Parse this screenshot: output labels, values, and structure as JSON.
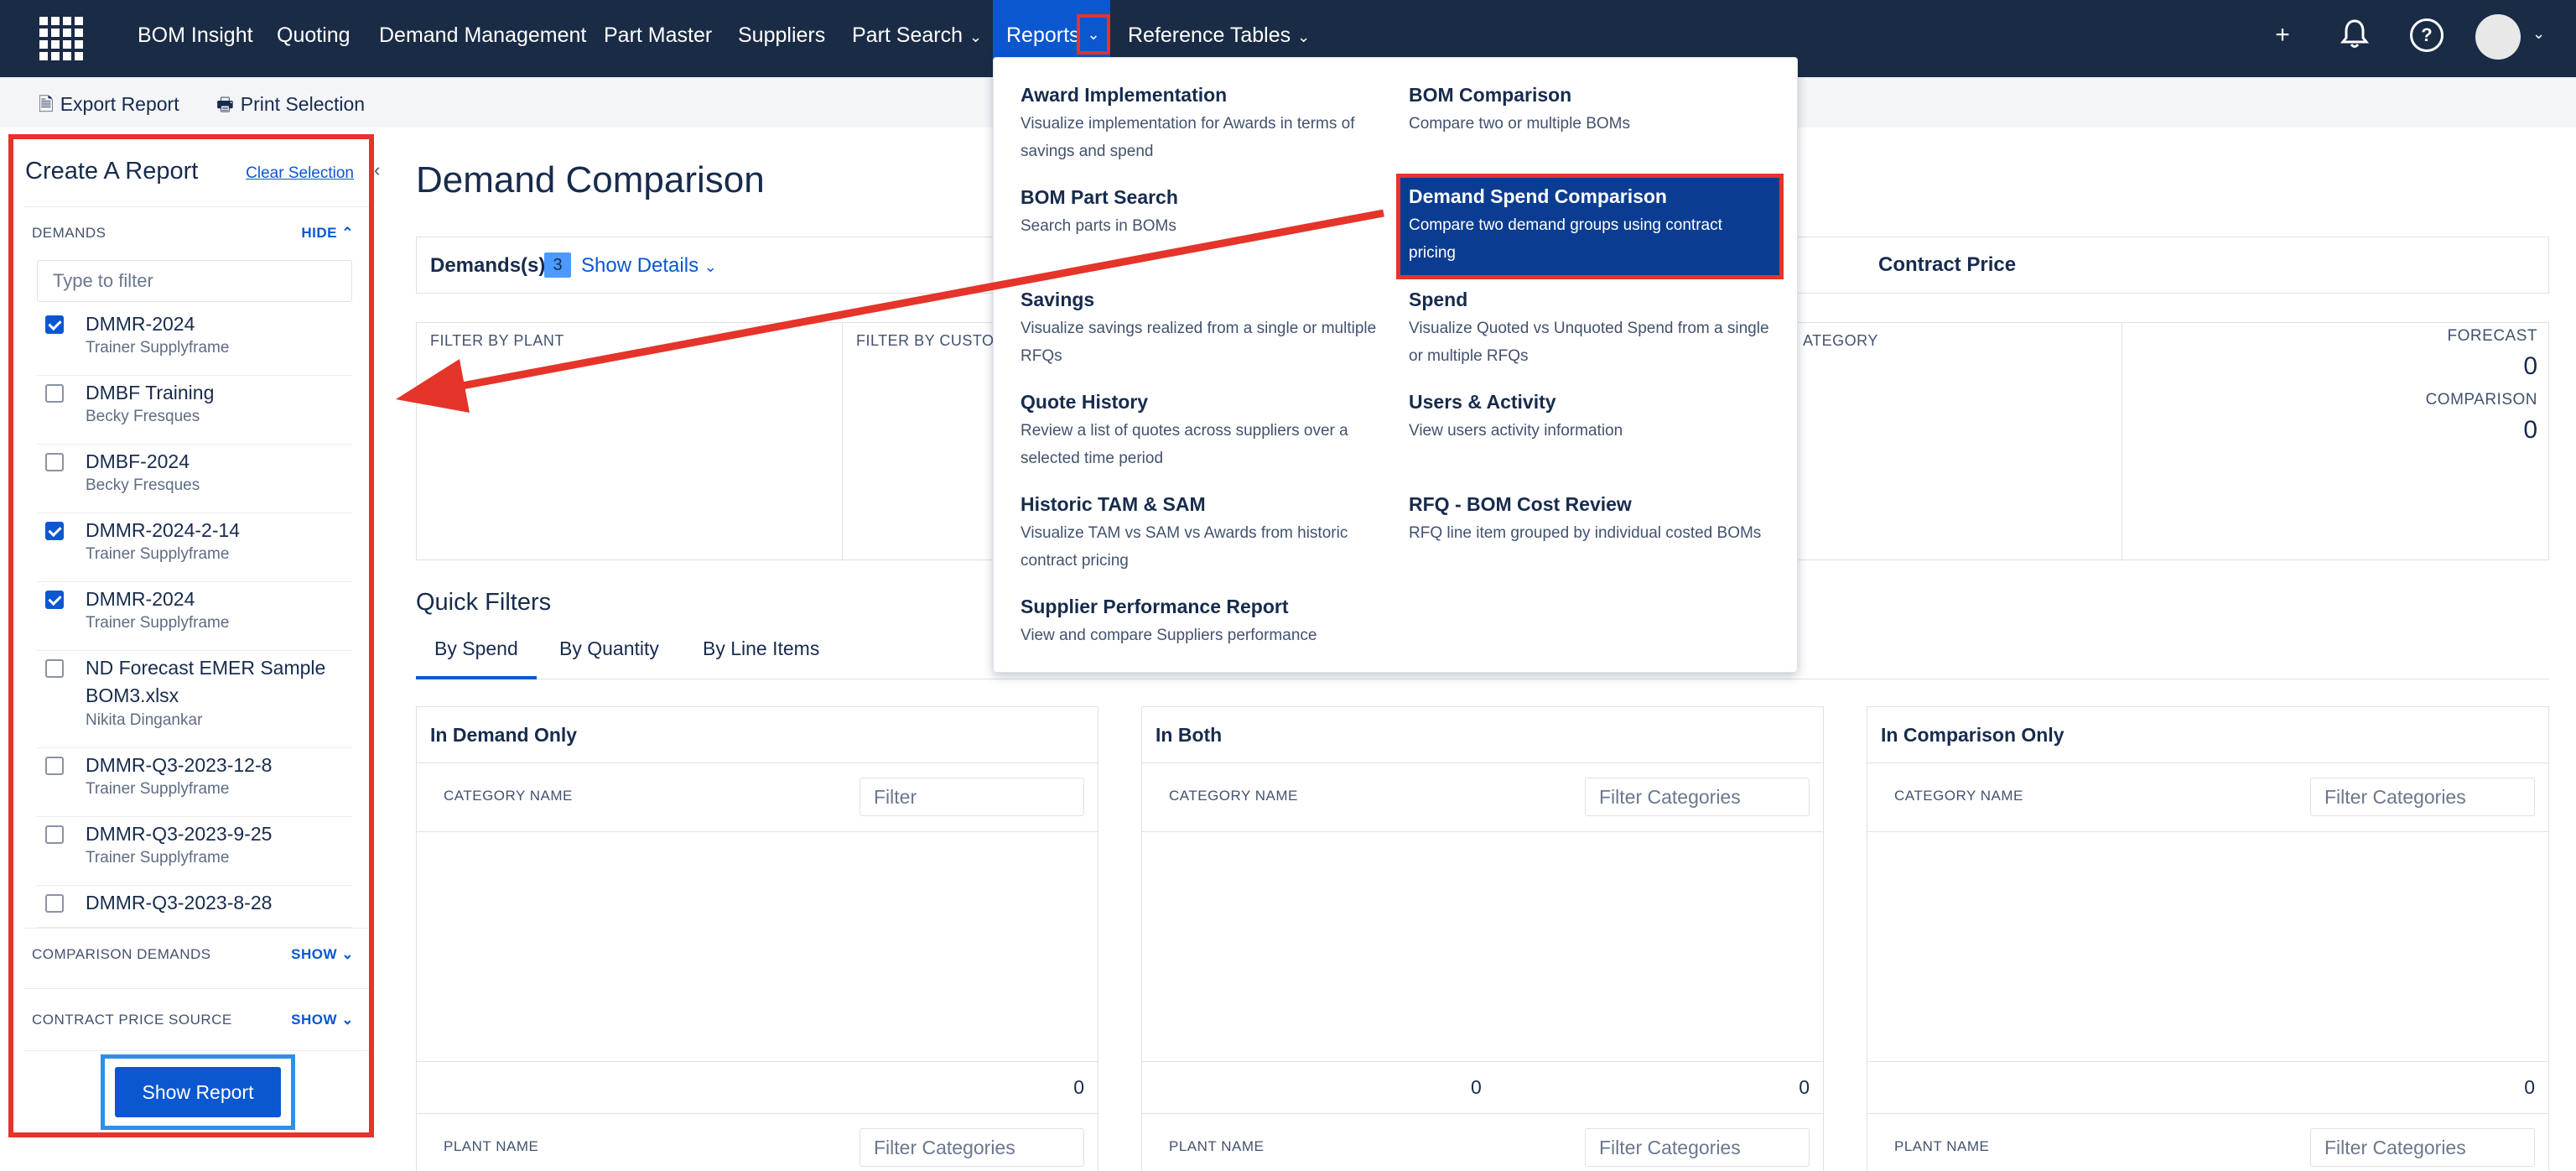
{
  "nav": {
    "items": [
      {
        "label": "BOM Insight"
      },
      {
        "label": "Quoting"
      },
      {
        "label": "Demand Management"
      },
      {
        "label": "Part Master"
      },
      {
        "label": "Suppliers"
      },
      {
        "label": "Part Search"
      },
      {
        "label": "Reports"
      },
      {
        "label": "Reference Tables"
      }
    ],
    "active": "Reports",
    "plus_icon": "+",
    "bell_icon": "bell-icon",
    "help_icon": "?"
  },
  "toolbar": {
    "export_label": "Export Report",
    "print_label": "Print Selection"
  },
  "sidebar": {
    "title": "Create A Report",
    "clear_label": "Clear Selection",
    "demands_label": "DEMANDS",
    "demands_toggle": "HIDE",
    "filter_placeholder": "Type to filter",
    "items": [
      {
        "name": "DMMR-2024",
        "owner": "Trainer Supplyframe",
        "checked": true
      },
      {
        "name": "DMBF Training",
        "owner": "Becky Fresques",
        "checked": false
      },
      {
        "name": "DMBF-2024",
        "owner": "Becky Fresques",
        "checked": false
      },
      {
        "name": "DMMR-2024-2-14",
        "owner": "Trainer Supplyframe",
        "checked": true
      },
      {
        "name": "DMMR-2024",
        "owner": "Trainer Supplyframe",
        "checked": true
      },
      {
        "name": "ND Forecast EMER Sample BOM3.xlsx",
        "owner": "Nikita Dingankar",
        "checked": false
      },
      {
        "name": "DMMR-Q3-2023-12-8",
        "owner": "Trainer Supplyframe",
        "checked": false
      },
      {
        "name": "DMMR-Q3-2023-9-25",
        "owner": "Trainer Supplyframe",
        "checked": false
      },
      {
        "name": "DMMR-Q3-2023-8-28",
        "owner": "",
        "checked": false
      }
    ],
    "comparison_label": "COMPARISON DEMANDS",
    "comparison_toggle": "SHOW",
    "contract_label": "CONTRACT PRICE SOURCE",
    "contract_toggle": "SHOW",
    "show_report_label": "Show Report"
  },
  "main": {
    "title": "Demand Comparison",
    "demands_label": "Demands(s)",
    "demands_count": "3",
    "show_details": "Show Details",
    "contract_price": "Contract Price",
    "filter_plant": "FILTER BY PLANT",
    "filter_customer": "FILTER BY CUSTOM",
    "filter_category": "ATEGORY",
    "forecast_label": "FORECAST",
    "forecast_value": "0",
    "comparison_label": "COMPARISON",
    "comparison_value": "0",
    "quick_filters": "Quick Filters",
    "tabs": [
      "By Spend",
      "By Quantity",
      "By Line Items"
    ],
    "panels": [
      {
        "title": "In Demand Only",
        "col": "CATEGORY NAME",
        "filter": "Filter",
        "num_left": "",
        "num_right": "0",
        "col2": "PLANT NAME",
        "filter2": "Filter Categories"
      },
      {
        "title": "In Both",
        "col": "CATEGORY NAME",
        "filter": "Filter Categories",
        "num_left": "0",
        "num_right": "0",
        "col2": "PLANT NAME",
        "filter2": "Filter Categories"
      },
      {
        "title": "In Comparison Only",
        "col": "CATEGORY NAME",
        "filter": "Filter Categories",
        "num_left": "",
        "num_right": "0",
        "col2": "PLANT NAME",
        "filter2": "Filter Categories"
      }
    ]
  },
  "reports_menu": {
    "left": [
      {
        "title": "Award Implementation",
        "desc": "Visualize implementation for Awards in terms of savings and spend"
      },
      {
        "title": "BOM Part Search",
        "desc": "Search parts in BOMs"
      },
      {
        "title": "Savings",
        "desc": "Visualize savings realized from a single or multiple RFQs"
      },
      {
        "title": "Quote History",
        "desc": "Review a list of quotes across suppliers over a selected time period"
      },
      {
        "title": "Historic TAM & SAM",
        "desc": "Visualize TAM vs SAM vs Awards from historic contract pricing"
      },
      {
        "title": "Supplier Performance Report",
        "desc": "View and compare Suppliers performance"
      }
    ],
    "right": [
      {
        "title": "BOM Comparison",
        "desc": "Compare two or multiple BOMs"
      },
      {
        "title": "Demand Spend Comparison",
        "desc": "Compare two demand groups using contract pricing"
      },
      {
        "title": "Spend",
        "desc": "Visualize Quoted vs Unquoted Spend from a single or multiple RFQs"
      },
      {
        "title": "Users & Activity",
        "desc": "View users activity information"
      },
      {
        "title": "RFQ - BOM Cost Review",
        "desc": "RFQ line item grouped by individual costed BOMs"
      }
    ],
    "selected": "Demand Spend Comparison"
  },
  "colors": {
    "nav_bg": "#1a2b45",
    "accent": "#0b57d0",
    "highlight_red": "#e5342a",
    "selected_item_bg": "#0a3d91"
  }
}
